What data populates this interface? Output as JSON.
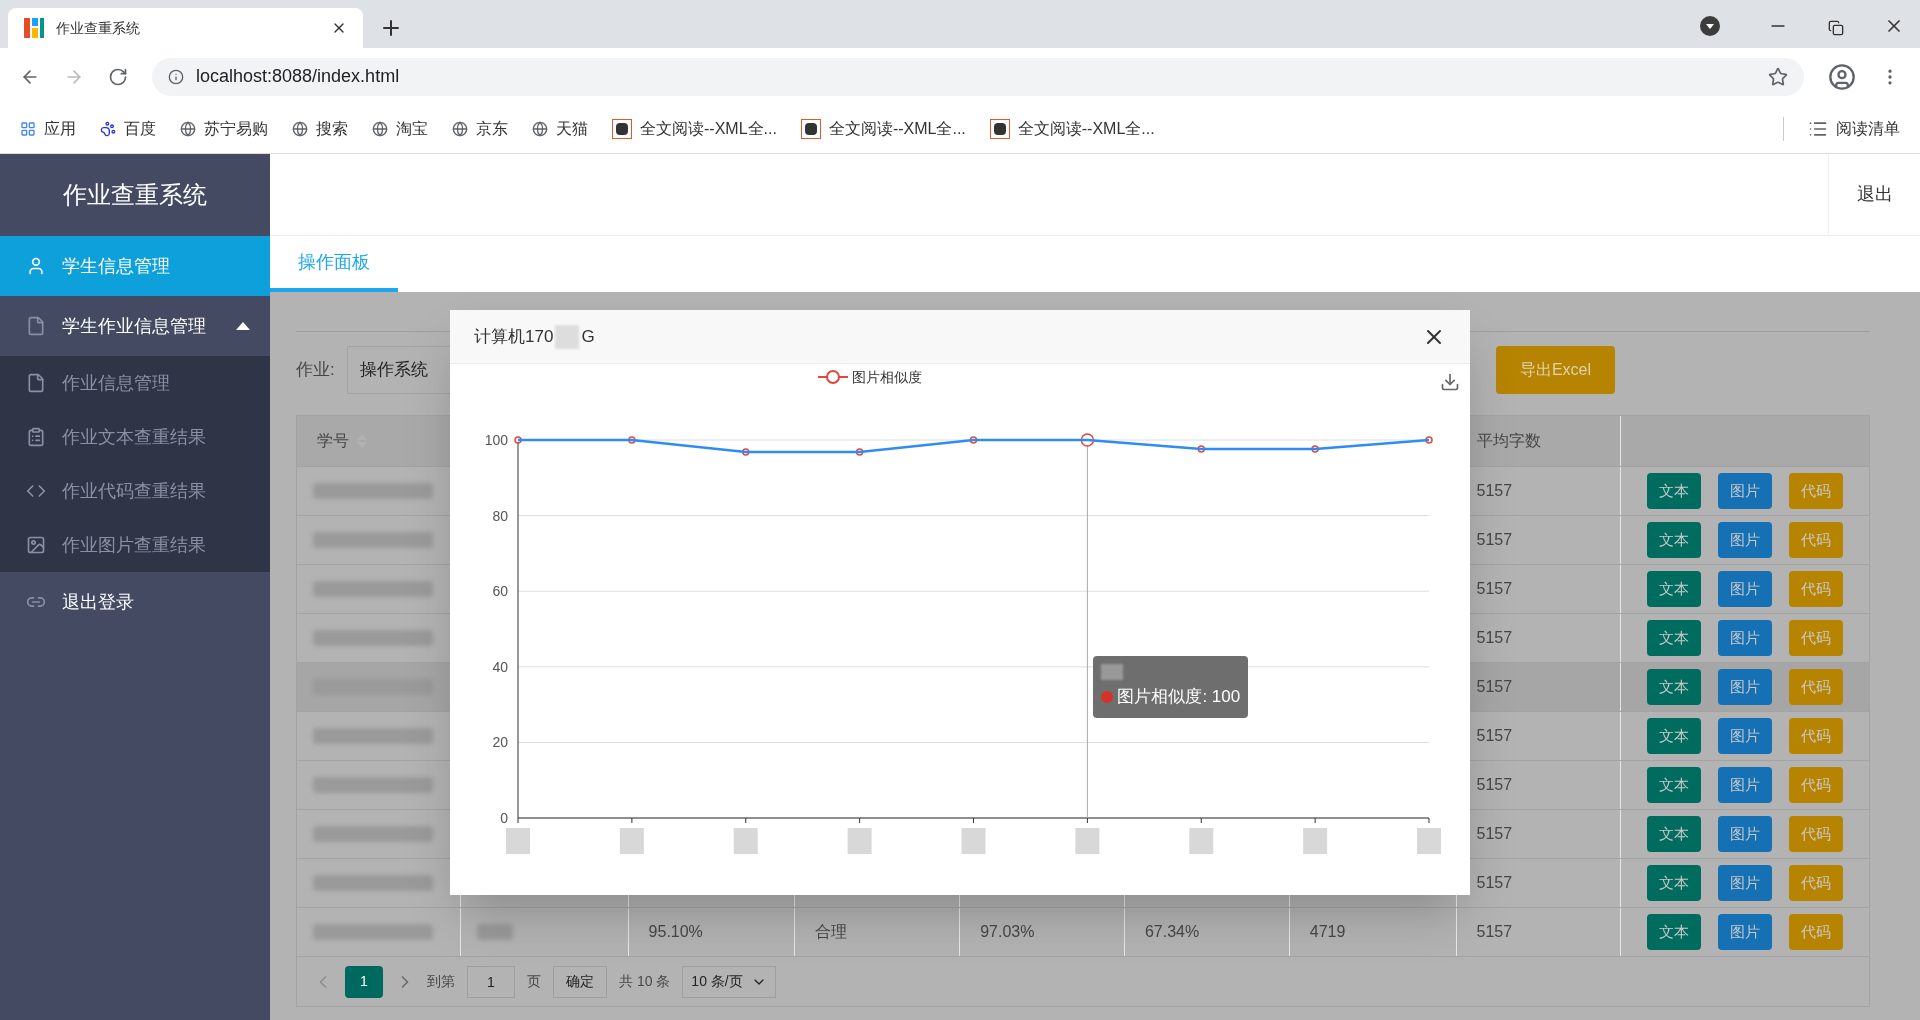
{
  "browser": {
    "tab": {
      "title": "作业查重系统"
    },
    "address": "localhost:8088/index.html",
    "bookmarks": [
      {
        "label": "应用",
        "kind": "apps"
      },
      {
        "label": "百度",
        "kind": "paw"
      },
      {
        "label": "苏宁易购",
        "kind": "globe"
      },
      {
        "label": "搜索",
        "kind": "globe"
      },
      {
        "label": "淘宝",
        "kind": "globe"
      },
      {
        "label": "京东",
        "kind": "globe"
      },
      {
        "label": "天猫",
        "kind": "globe"
      },
      {
        "label": "全文阅读--XML全...",
        "kind": "zhi"
      },
      {
        "label": "全文阅读--XML全...",
        "kind": "zhi"
      },
      {
        "label": "全文阅读--XML全...",
        "kind": "zhi"
      }
    ],
    "reading_list": "阅读清单"
  },
  "sidebar": {
    "title": "作业查重系统",
    "items": [
      {
        "label": "学生信息管理",
        "kind": "user",
        "selected": true
      },
      {
        "label": "学生作业信息管理",
        "kind": "file",
        "selected": false,
        "expanded": true,
        "children": [
          {
            "label": "作业信息管理",
            "kind": "file",
            "selected": false
          },
          {
            "label": "作业文本查重结果",
            "kind": "clipboard",
            "selected": false
          },
          {
            "label": "作业代码查重结果",
            "kind": "code",
            "selected": false
          },
          {
            "label": "作业图片查重结果",
            "kind": "image",
            "selected": false
          }
        ]
      },
      {
        "label": "退出登录",
        "kind": "link",
        "selected": false
      }
    ]
  },
  "header": {
    "logout": "退出"
  },
  "tabs": [
    {
      "label": "操作面板",
      "selected": true
    }
  ],
  "page": {
    "filter_label": "作业:",
    "assignment": "操作系统",
    "export": "导出Excel",
    "table": {
      "id_column": {
        "label": "学号",
        "sortable": true
      },
      "avg_column": {
        "label": "平均字数"
      },
      "rows": [
        {
          "hovered": false,
          "avg_words": "5157",
          "actions": [
            {
              "label": "文本",
              "color": "#006b5f"
            },
            {
              "label": "图片",
              "color": "#1570b4"
            },
            {
              "label": "代码",
              "color": "#b68400"
            }
          ]
        },
        {
          "hovered": false,
          "avg_words": "5157",
          "actions": [
            {
              "label": "文本",
              "color": "#006b5f"
            },
            {
              "label": "图片",
              "color": "#1570b4"
            },
            {
              "label": "代码",
              "color": "#b68400"
            }
          ]
        },
        {
          "hovered": false,
          "avg_words": "5157",
          "actions": [
            {
              "label": "文本",
              "color": "#006b5f"
            },
            {
              "label": "图片",
              "color": "#1570b4"
            },
            {
              "label": "代码",
              "color": "#b68400"
            }
          ]
        },
        {
          "hovered": false,
          "avg_words": "5157",
          "actions": [
            {
              "label": "文本",
              "color": "#006b5f"
            },
            {
              "label": "图片",
              "color": "#1570b4"
            },
            {
              "label": "代码",
              "color": "#b68400"
            }
          ]
        },
        {
          "hovered": true,
          "avg_words": "5157",
          "actions": [
            {
              "label": "文本",
              "color": "#006b5f"
            },
            {
              "label": "图片",
              "color": "#1570b4"
            },
            {
              "label": "代码",
              "color": "#b68400"
            }
          ]
        },
        {
          "hovered": false,
          "avg_words": "5157",
          "actions": [
            {
              "label": "文本",
              "color": "#006b5f"
            },
            {
              "label": "图片",
              "color": "#1570b4"
            },
            {
              "label": "代码",
              "color": "#b68400"
            }
          ]
        },
        {
          "hovered": false,
          "avg_words": "5157",
          "actions": [
            {
              "label": "文本",
              "color": "#006b5f"
            },
            {
              "label": "图片",
              "color": "#1570b4"
            },
            {
              "label": "代码",
              "color": "#b68400"
            }
          ]
        },
        {
          "hovered": false,
          "avg_words": "5157",
          "actions": [
            {
              "label": "文本",
              "color": "#006b5f"
            },
            {
              "label": "图片",
              "color": "#1570b4"
            },
            {
              "label": "代码",
              "color": "#b68400"
            }
          ]
        },
        {
          "hovered": false,
          "avg_words": "5157",
          "actions": [
            {
              "label": "文本",
              "color": "#006b5f"
            },
            {
              "label": "图片",
              "color": "#1570b4"
            },
            {
              "label": "代码",
              "color": "#b68400"
            }
          ]
        },
        {
          "hovered": false,
          "column_3": "95.10%",
          "column_4": "合理",
          "column_5": "97.03%",
          "column_6": "67.34%",
          "column_7": "4719",
          "avg_words": "5157",
          "actions": [
            {
              "label": "文本",
              "color": "#006b5f"
            },
            {
              "label": "图片",
              "color": "#1570b4"
            },
            {
              "label": "代码",
              "color": "#b68400"
            }
          ]
        }
      ]
    },
    "pagination": {
      "pages": [
        {
          "label": "1",
          "selected": true
        }
      ],
      "goto_label": "到第",
      "goto_value": "1",
      "page_unit": "页",
      "confirm": "确定",
      "total": "共 10 条",
      "page_size": "10 条/页"
    }
  },
  "modal": {
    "title": "计算机170",
    "title_end": "G",
    "chart_data": {
      "type": "line",
      "grid": true,
      "series": [
        {
          "name": "图片相似度",
          "color": "#2f8cf5",
          "marker": "circle",
          "values": [
            100,
            100,
            96.8,
            96.8,
            100,
            100,
            97.6,
            97.6,
            100
          ]
        }
      ],
      "ylim": [
        0,
        100
      ],
      "yticks": [
        0,
        20,
        40,
        60,
        80,
        100
      ]
    },
    "tooltip": {
      "text": "图片相似度: 100"
    }
  }
}
